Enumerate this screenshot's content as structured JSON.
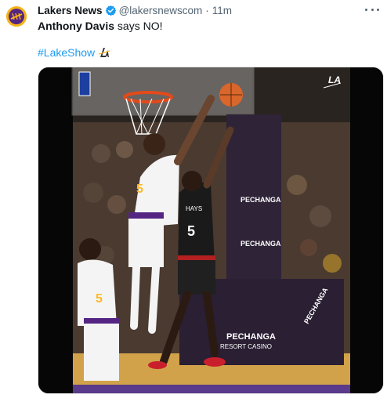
{
  "tweet": {
    "author_name": "Lakers News",
    "handle": "@lakersnewscom",
    "separator": "·",
    "time": "11m",
    "text_bold": "Anthony Davis",
    "text_rest": " says NO!",
    "hashtag": "#LakeShow",
    "more_icon": "more-horizontal-icon"
  },
  "media": {
    "jersey_lakers": "5",
    "jersey_opponent": "5",
    "opponent_name": "HAYS",
    "sign_brand": "PECHANGA",
    "sign_sub": "RESORT CASINO",
    "side_sign_brand": "PECHANGA",
    "watermark": "LA"
  },
  "colors": {
    "link": "#1d9bf0",
    "verified": "#1d9bf0",
    "lakers_gold": "#fdb927",
    "lakers_purple": "#552583"
  }
}
